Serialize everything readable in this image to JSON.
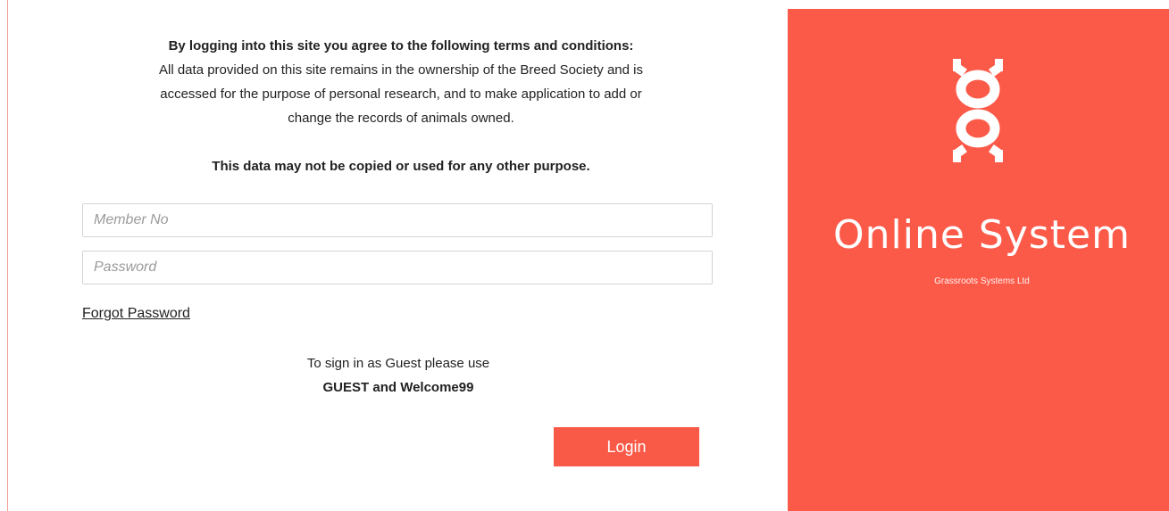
{
  "terms": {
    "heading": "By logging into this site you agree to the following terms and conditions:",
    "line1": "All data provided on this site remains in the ownership of the Breed Society and is",
    "line2": "accessed for the purpose of personal research, and to make application to add or",
    "line3": "change the records of animals owned.",
    "warning": "This data may not be copied or used for any other purpose."
  },
  "form": {
    "member_placeholder": "Member No",
    "member_value": "",
    "password_placeholder": "Password",
    "password_value": "",
    "forgot_label": "Forgot Password",
    "login_label": "Login"
  },
  "guest": {
    "line1": "To sign in as Guest please use",
    "line2": "GUEST and Welcome99"
  },
  "brand": {
    "title": "Online System",
    "subtitle": "Grassroots Systems Ltd",
    "logo_icon": "dna-helix-icon",
    "accent_color": "#fc5a49"
  }
}
